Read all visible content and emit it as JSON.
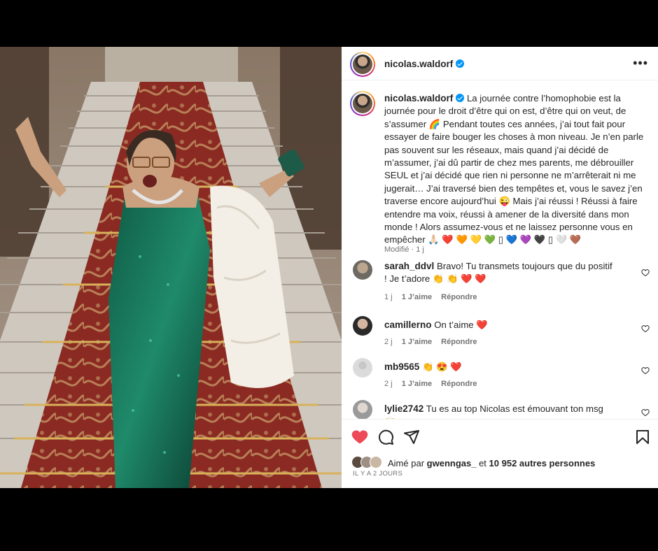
{
  "post": {
    "username": "nicolas.waldorf",
    "caption": "La journée contre l’homophobie est la journée pour le droit d’être qui on est, d’être qui on veut, de s’assumer 🌈 Pendant toutes ces années, j’ai tout fait pour essayer de faire bouger les choses à mon niveau. Je n’en parle pas souvent sur les réseaux, mais quand j’ai décidé de m’assumer, j’ai dû partir de chez mes parents, me débrouiller SEUL et j’ai décidé que rien ni personne ne m’arrêterait ni me jugerait… J’ai traversé bien des tempêtes et, vous le savez j’en traverse encore aujourd’hui 😜 Mais j’ai réussi ! Réussi à faire entendre ma voix, réussi à amener de la diversité dans mon monde ! Alors assumez-vous et ne laissez personne vous en empêcher 🙏🏻 ❤️ 🧡 💛 💚 ▯ 💙 💜 🖤 ▯ 🤍 🤎",
    "edited_label": "Modifié",
    "age": "1 j"
  },
  "comments": [
    {
      "user": "sarah_ddvl",
      "text": "Bravo! Tu transmets toujours que du positif ! Je t’adore 👏 👏 ❤️ ❤️",
      "age": "1 j",
      "likes": "1 J’aime",
      "reply": "Répondre"
    },
    {
      "user": "camillerno",
      "text": "On t’aime ❤️",
      "age": "2 j",
      "likes": "1 J’aime",
      "reply": "Répondre"
    },
    {
      "user": "mb9565",
      "text": "👏 😍 ❤️",
      "age": "2 j",
      "likes": "1 J’aime",
      "reply": "Répondre"
    },
    {
      "user": "lylie2742",
      "text": "Tu es au top Nicolas est émouvant ton msg 🙌",
      "age": "",
      "likes": "",
      "reply": ""
    }
  ],
  "likes": {
    "prefix": "Aimé par",
    "first_user": "gwenngas_",
    "middle": "et",
    "count_text": "10 952 autres personnes"
  },
  "date": "IL Y A 2 JOURS",
  "colors": {
    "liked_heart": "#ed4956",
    "verified": "#0095f6",
    "link_gray": "#737373"
  },
  "icons": [
    "more-icon",
    "heart-icon",
    "comment-icon",
    "share-icon",
    "save-icon",
    "verified-icon"
  ]
}
